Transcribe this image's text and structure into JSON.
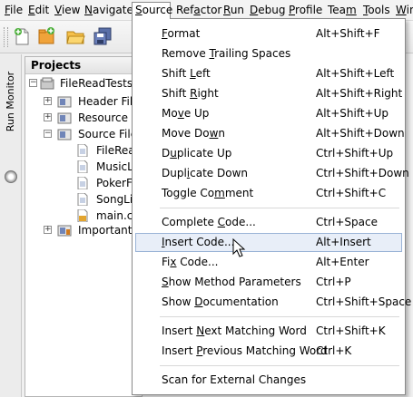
{
  "menubar": {
    "items": [
      {
        "pre": "",
        "mn": "F",
        "post": "ile"
      },
      {
        "pre": "",
        "mn": "E",
        "post": "dit"
      },
      {
        "pre": "",
        "mn": "V",
        "post": "iew"
      },
      {
        "pre": "",
        "mn": "N",
        "post": "avigate"
      },
      {
        "pre": "",
        "mn": "S",
        "post": "ource"
      },
      {
        "pre": "Ref",
        "mn": "a",
        "post": "ctor"
      },
      {
        "pre": "",
        "mn": "R",
        "post": "un"
      },
      {
        "pre": "",
        "mn": "D",
        "post": "ebug"
      },
      {
        "pre": "",
        "mn": "P",
        "post": "rofile"
      },
      {
        "pre": "Tea",
        "mn": "m",
        "post": ""
      },
      {
        "pre": "",
        "mn": "T",
        "post": "ools"
      },
      {
        "pre": "",
        "mn": "W",
        "post": "in"
      }
    ]
  },
  "toolbar": {
    "icons": [
      "new-file-icon",
      "new-project-icon",
      "open-project-icon",
      "save-all-icon"
    ]
  },
  "side_panel": {
    "run_monitor_label": "Run Monitor"
  },
  "projects": {
    "title": "Projects",
    "tree": [
      {
        "label": "FileReadTests",
        "icon": "project-icon"
      },
      {
        "label": "Header Files",
        "icon": "folder-icon"
      },
      {
        "label": "Resource Fil",
        "icon": "folder-icon"
      },
      {
        "label": "Source Files",
        "icon": "folder-icon"
      },
      {
        "label": "FileRead",
        "icon": "file-icon"
      },
      {
        "label": "MusicLib",
        "icon": "file-icon"
      },
      {
        "label": "PokerFa",
        "icon": "file-icon"
      },
      {
        "label": "SongLib",
        "icon": "file-icon"
      },
      {
        "label": "main.cp",
        "icon": "file-icon"
      },
      {
        "label": "Important F",
        "icon": "folder-icon"
      }
    ]
  },
  "source_menu": {
    "items": [
      {
        "pre": "",
        "mn": "F",
        "post": "ormat",
        "shortcut": "Alt+Shift+F"
      },
      {
        "pre": "Remove ",
        "mn": "T",
        "post": "railing Spaces",
        "shortcut": ""
      },
      {
        "pre": "Shift ",
        "mn": "L",
        "post": "eft",
        "shortcut": "Alt+Shift+Left"
      },
      {
        "pre": "Shift ",
        "mn": "R",
        "post": "ight",
        "shortcut": "Alt+Shift+Right"
      },
      {
        "pre": "Mo",
        "mn": "v",
        "post": "e Up",
        "shortcut": "Alt+Shift+Up"
      },
      {
        "pre": "Move Do",
        "mn": "w",
        "post": "n",
        "shortcut": "Alt+Shift+Down"
      },
      {
        "pre": "D",
        "mn": "u",
        "post": "plicate Up",
        "shortcut": "Ctrl+Shift+Up"
      },
      {
        "pre": "Dupl",
        "mn": "i",
        "post": "cate Down",
        "shortcut": "Ctrl+Shift+Down"
      },
      {
        "pre": "Toggle Co",
        "mn": "m",
        "post": "ment",
        "shortcut": "Ctrl+Shift+C"
      },
      {
        "pre": "Complete ",
        "mn": "C",
        "post": "ode...",
        "shortcut": "Ctrl+Space"
      },
      {
        "pre": "",
        "mn": "I",
        "post": "nsert Code...",
        "shortcut": "Alt+Insert"
      },
      {
        "pre": "Fi",
        "mn": "x",
        "post": " Code...",
        "shortcut": "Alt+Enter"
      },
      {
        "pre": "",
        "mn": "S",
        "post": "how Method Parameters",
        "shortcut": "Ctrl+P"
      },
      {
        "pre": "Show ",
        "mn": "D",
        "post": "ocumentation",
        "shortcut": "Ctrl+Shift+Space"
      },
      {
        "pre": "Insert ",
        "mn": "N",
        "post": "ext Matching Word",
        "shortcut": "Ctrl+Shift+K"
      },
      {
        "pre": "Insert ",
        "mn": "P",
        "post": "revious Matching Word",
        "shortcut": "Ctrl+K"
      },
      {
        "pre": "Scan for External Changes",
        "mn": "",
        "post": "",
        "shortcut": ""
      }
    ]
  }
}
